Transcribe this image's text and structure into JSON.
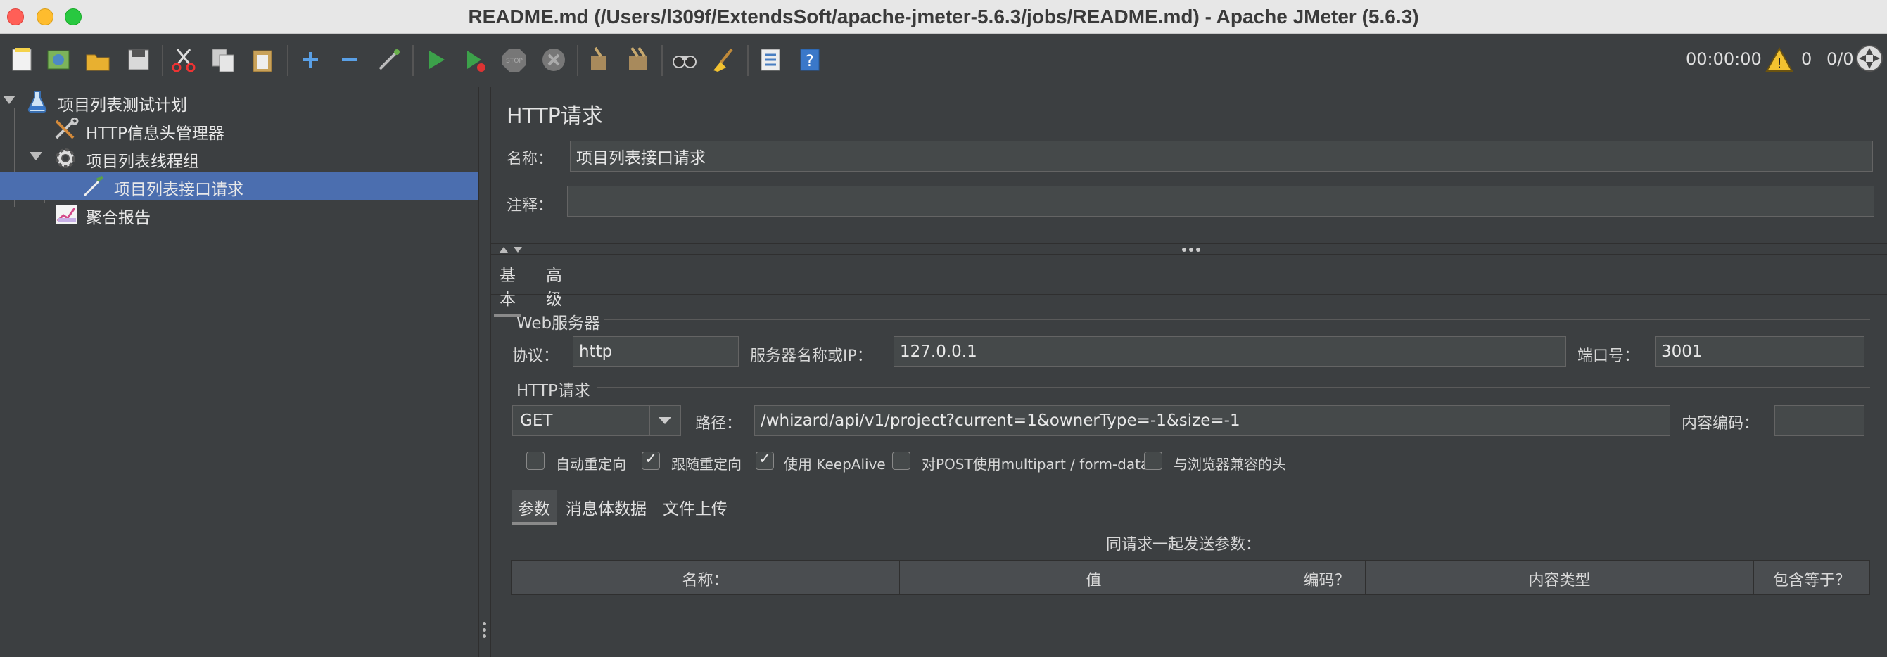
{
  "window": {
    "title": "README.md (/Users/l309f/ExtendsSoft/apache-jmeter-5.6.3/jobs/README.md) - Apache JMeter (5.6.3)"
  },
  "toolbar": {
    "icons": [
      "new-icon",
      "templates-icon",
      "open-icon",
      "save-icon",
      "cut-icon",
      "copy-icon",
      "paste-icon",
      "expand-icon",
      "collapse-icon",
      "toggle-icon",
      "start-icon",
      "start-no-pauses-icon",
      "stop-icon",
      "shutdown-icon",
      "clear-icon",
      "clear-all-icon",
      "search-icon",
      "reset-search-icon",
      "function-helper-icon",
      "help-icon"
    ],
    "timer": "00:00:00",
    "warning_count": "0",
    "threads": "0/0"
  },
  "tree": {
    "items": [
      {
        "label": "项目列表测试计划",
        "icon": "test-plan-flask-icon",
        "level": 0,
        "expanded": true
      },
      {
        "label": "HTTP信息头管理器",
        "icon": "header-manager-tools-icon",
        "level": 1
      },
      {
        "label": "项目列表线程组",
        "icon": "thread-group-gear-icon",
        "level": 1,
        "expanded": true
      },
      {
        "label": "项目列表接口请求",
        "icon": "sampler-pipette-icon",
        "level": 2,
        "selected": true
      },
      {
        "label": "聚合报告",
        "icon": "aggregate-report-chart-icon",
        "level": 1
      }
    ]
  },
  "panel": {
    "title": "HTTP请求",
    "name_label": "名称：",
    "name_value": "项目列表接口请求",
    "comment_label": "注释：",
    "comment_value": "",
    "tabs": [
      "基本",
      "高级"
    ],
    "web_server": {
      "group_title": "Web服务器",
      "protocol_label": "协议：",
      "protocol_value": "http",
      "server_label": "服务器名称或IP：",
      "server_value": "127.0.0.1",
      "port_label": "端口号：",
      "port_value": "3001"
    },
    "http_request": {
      "group_title": "HTTP请求",
      "method": "GET",
      "path_label": "路径：",
      "path_value": "/whizard/api/v1/project?current=1&ownerType=-1&size=-1",
      "encoding_label": "内容编码：",
      "encoding_value": ""
    },
    "checkboxes": [
      {
        "label": "自动重定向",
        "checked": false
      },
      {
        "label": "跟随重定向",
        "checked": true
      },
      {
        "label": "使用 KeepAlive",
        "checked": true
      },
      {
        "label": "对POST使用multipart / form-data",
        "checked": false
      },
      {
        "label": "与浏览器兼容的头",
        "checked": false
      }
    ],
    "subtabs": [
      "参数",
      "消息体数据",
      "文件上传"
    ],
    "params_caption": "同请求一起发送参数：",
    "columns": [
      "名称：",
      "值",
      "编码？",
      "内容类型",
      "包含等于？"
    ]
  }
}
